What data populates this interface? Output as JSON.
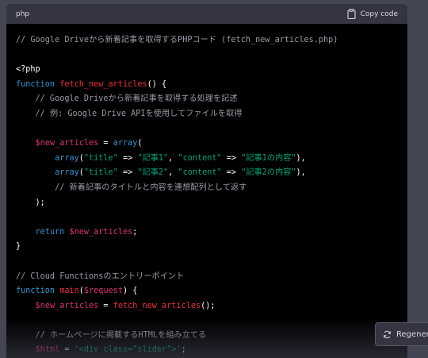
{
  "code_block": {
    "language": "php",
    "copy_label": "Copy code",
    "lines": [
      [
        {
          "t": "// Google Driveから新着記事を取得するPHPコード (fetch_new_articles.php)",
          "c": "c"
        }
      ],
      [],
      [
        {
          "t": "<?php",
          "c": "p"
        }
      ],
      [
        {
          "t": "function",
          "c": "k"
        },
        {
          "t": " ",
          "c": "p"
        },
        {
          "t": "fetch_new_articles",
          "c": "f"
        },
        {
          "t": "() {",
          "c": "p"
        }
      ],
      [
        {
          "t": "    // Google Driveから新着記事を取得する処理を記述",
          "c": "c"
        }
      ],
      [
        {
          "t": "    // 例: Google Drive APIを使用してファイルを取得",
          "c": "c"
        }
      ],
      [],
      [
        {
          "t": "    ",
          "c": "p"
        },
        {
          "t": "$new_articles",
          "c": "v"
        },
        {
          "t": " = ",
          "c": "p"
        },
        {
          "t": "array",
          "c": "k"
        },
        {
          "t": "(",
          "c": "p"
        }
      ],
      [
        {
          "t": "        ",
          "c": "p"
        },
        {
          "t": "array",
          "c": "k"
        },
        {
          "t": "(",
          "c": "p"
        },
        {
          "t": "\"title\"",
          "c": "s"
        },
        {
          "t": " => ",
          "c": "p"
        },
        {
          "t": "\"記事1\"",
          "c": "s"
        },
        {
          "t": ", ",
          "c": "p"
        },
        {
          "t": "\"content\"",
          "c": "s"
        },
        {
          "t": " => ",
          "c": "p"
        },
        {
          "t": "\"記事1の内容\"",
          "c": "s"
        },
        {
          "t": "),",
          "c": "p"
        }
      ],
      [
        {
          "t": "        ",
          "c": "p"
        },
        {
          "t": "array",
          "c": "k"
        },
        {
          "t": "(",
          "c": "p"
        },
        {
          "t": "\"title\"",
          "c": "s"
        },
        {
          "t": " => ",
          "c": "p"
        },
        {
          "t": "\"記事2\"",
          "c": "s"
        },
        {
          "t": ", ",
          "c": "p"
        },
        {
          "t": "\"content\"",
          "c": "s"
        },
        {
          "t": " => ",
          "c": "p"
        },
        {
          "t": "\"記事2の内容\"",
          "c": "s"
        },
        {
          "t": "),",
          "c": "p"
        }
      ],
      [
        {
          "t": "        // 新着記事のタイトルと内容を連想配列として返す",
          "c": "c"
        }
      ],
      [
        {
          "t": "    );",
          "c": "p"
        }
      ],
      [],
      [
        {
          "t": "    ",
          "c": "p"
        },
        {
          "t": "return",
          "c": "k"
        },
        {
          "t": " ",
          "c": "p"
        },
        {
          "t": "$new_articles",
          "c": "v"
        },
        {
          "t": ";",
          "c": "p"
        }
      ],
      [
        {
          "t": "}",
          "c": "p"
        }
      ],
      [],
      [
        {
          "t": "// Cloud Functionsのエントリーポイント",
          "c": "c"
        }
      ],
      [
        {
          "t": "function",
          "c": "k"
        },
        {
          "t": " ",
          "c": "p"
        },
        {
          "t": "main",
          "c": "f"
        },
        {
          "t": "(",
          "c": "p"
        },
        {
          "t": "$request",
          "c": "v"
        },
        {
          "t": ") {",
          "c": "p"
        }
      ],
      [
        {
          "t": "    ",
          "c": "p"
        },
        {
          "t": "$new_articles",
          "c": "v"
        },
        {
          "t": " = ",
          "c": "p"
        },
        {
          "t": "fetch_new_articles",
          "c": "f"
        },
        {
          "t": "();",
          "c": "p"
        }
      ],
      [],
      [
        {
          "t": "    // ホームページに掲載するHTMLを組み立てる",
          "c": "c"
        }
      ],
      [
        {
          "t": "    ",
          "c": "p"
        },
        {
          "t": "$html",
          "c": "v"
        },
        {
          "t": " = ",
          "c": "p"
        },
        {
          "t": "'<div class=\"slider\">'",
          "c": "s"
        },
        {
          "t": ";",
          "c": "p"
        }
      ]
    ]
  },
  "regenerate_label": "Regener",
  "colors": {
    "comment": "#9a9aa8",
    "keyword": "#2e95d3",
    "function": "#f22c3d",
    "variable": "#df3079",
    "string": "#00a67d",
    "plain": "#ffffff"
  }
}
